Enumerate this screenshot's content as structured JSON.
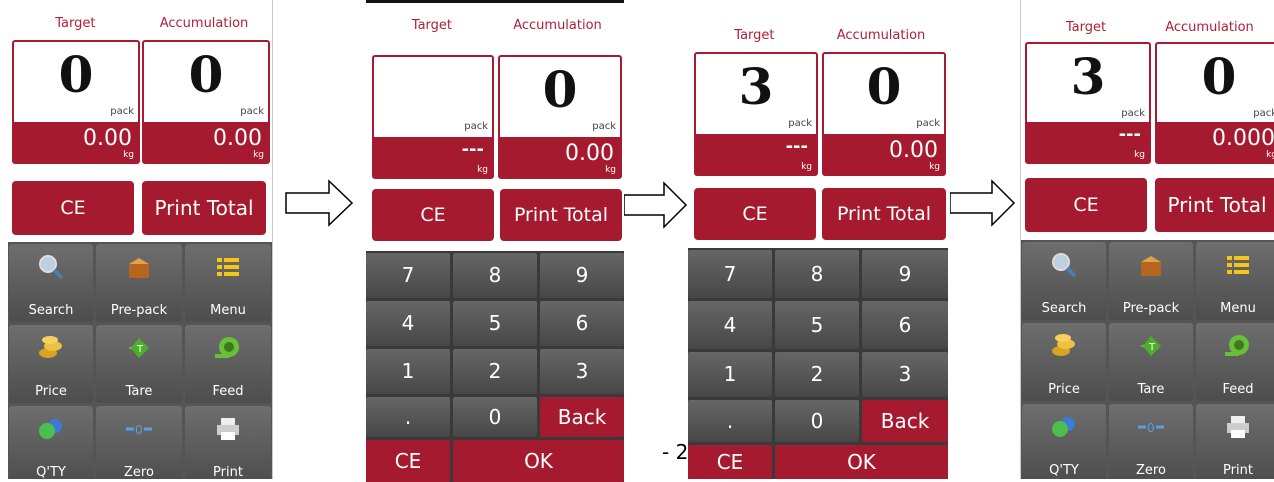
{
  "labels": {
    "target": "Target",
    "accumulation": "Accumulation",
    "pack": "pack",
    "kg": "kg"
  },
  "buttons": {
    "ce": "CE",
    "print_total": "Print Total",
    "back": "Back",
    "ok": "OK"
  },
  "panels": [
    {
      "target_value": "0",
      "accum_value": "0",
      "target_weight": "0.00",
      "accum_weight": "0.00"
    },
    {
      "target_value": "",
      "accum_value": "0",
      "target_weight": "---",
      "accum_weight": "0.00"
    },
    {
      "target_value": "3",
      "accum_value": "0",
      "target_weight": "---",
      "accum_weight": "0.00"
    },
    {
      "target_value": "3",
      "accum_value": "0",
      "target_weight": "---",
      "accum_weight": "0.000"
    }
  ],
  "function_grid": [
    {
      "label": "Search",
      "icon": "magnifier-icon"
    },
    {
      "label": "Pre-pack",
      "icon": "box-icon"
    },
    {
      "label": "Menu",
      "icon": "list-icon"
    },
    {
      "label": "Price",
      "icon": "coins-icon"
    },
    {
      "label": "Tare",
      "icon": "tare-icon"
    },
    {
      "label": "Feed",
      "icon": "paper-roll-icon"
    },
    {
      "label": "Q'TY",
      "icon": "quantity-balls-icon"
    },
    {
      "label": "Zero",
      "icon": "zero-icon"
    },
    {
      "label": "Print",
      "icon": "printer-icon"
    }
  ],
  "keypad": [
    "7",
    "8",
    "9",
    "4",
    "5",
    "6",
    "1",
    "2",
    "3",
    ".",
    "0"
  ],
  "footer_fragment": "- 2",
  "colors": {
    "accent": "#a61a30",
    "label_red": "#b01f37",
    "grid_dark": "#555555"
  }
}
